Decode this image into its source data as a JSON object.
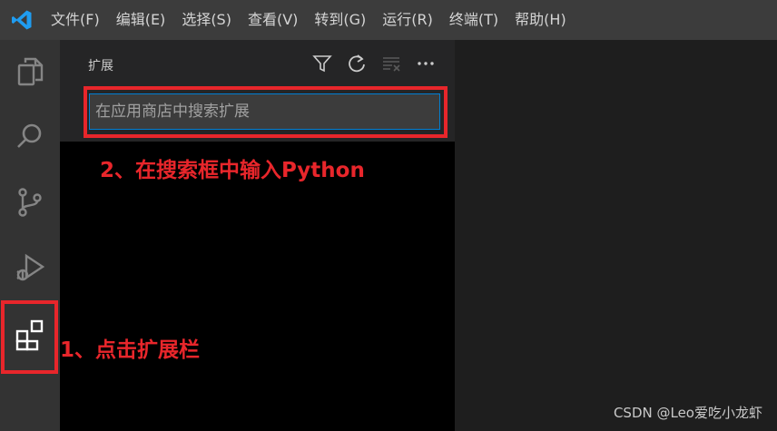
{
  "menu": {
    "items": [
      "文件(F)",
      "编辑(E)",
      "选择(S)",
      "查看(V)",
      "转到(G)",
      "运行(R)",
      "终端(T)",
      "帮助(H)"
    ]
  },
  "activitybar": {
    "icons": [
      "files-icon",
      "search-icon",
      "source-control-icon",
      "run-debug-icon",
      "extensions-icon"
    ]
  },
  "sidebar": {
    "title": "扩展",
    "search_placeholder": "在应用商店中搜索扩展"
  },
  "annotations": {
    "step1": "1、点击扩展栏",
    "step2": "2、在搜索框中输入Python",
    "color": "#e8262b"
  },
  "watermark": "CSDN @Leo爱吃小龙虾",
  "colors": {
    "titlebar": "#3c3c3c",
    "activitybar": "#333333",
    "sidebar": "#252526",
    "editor": "#1e1e1e",
    "accent": "#007fd4"
  }
}
